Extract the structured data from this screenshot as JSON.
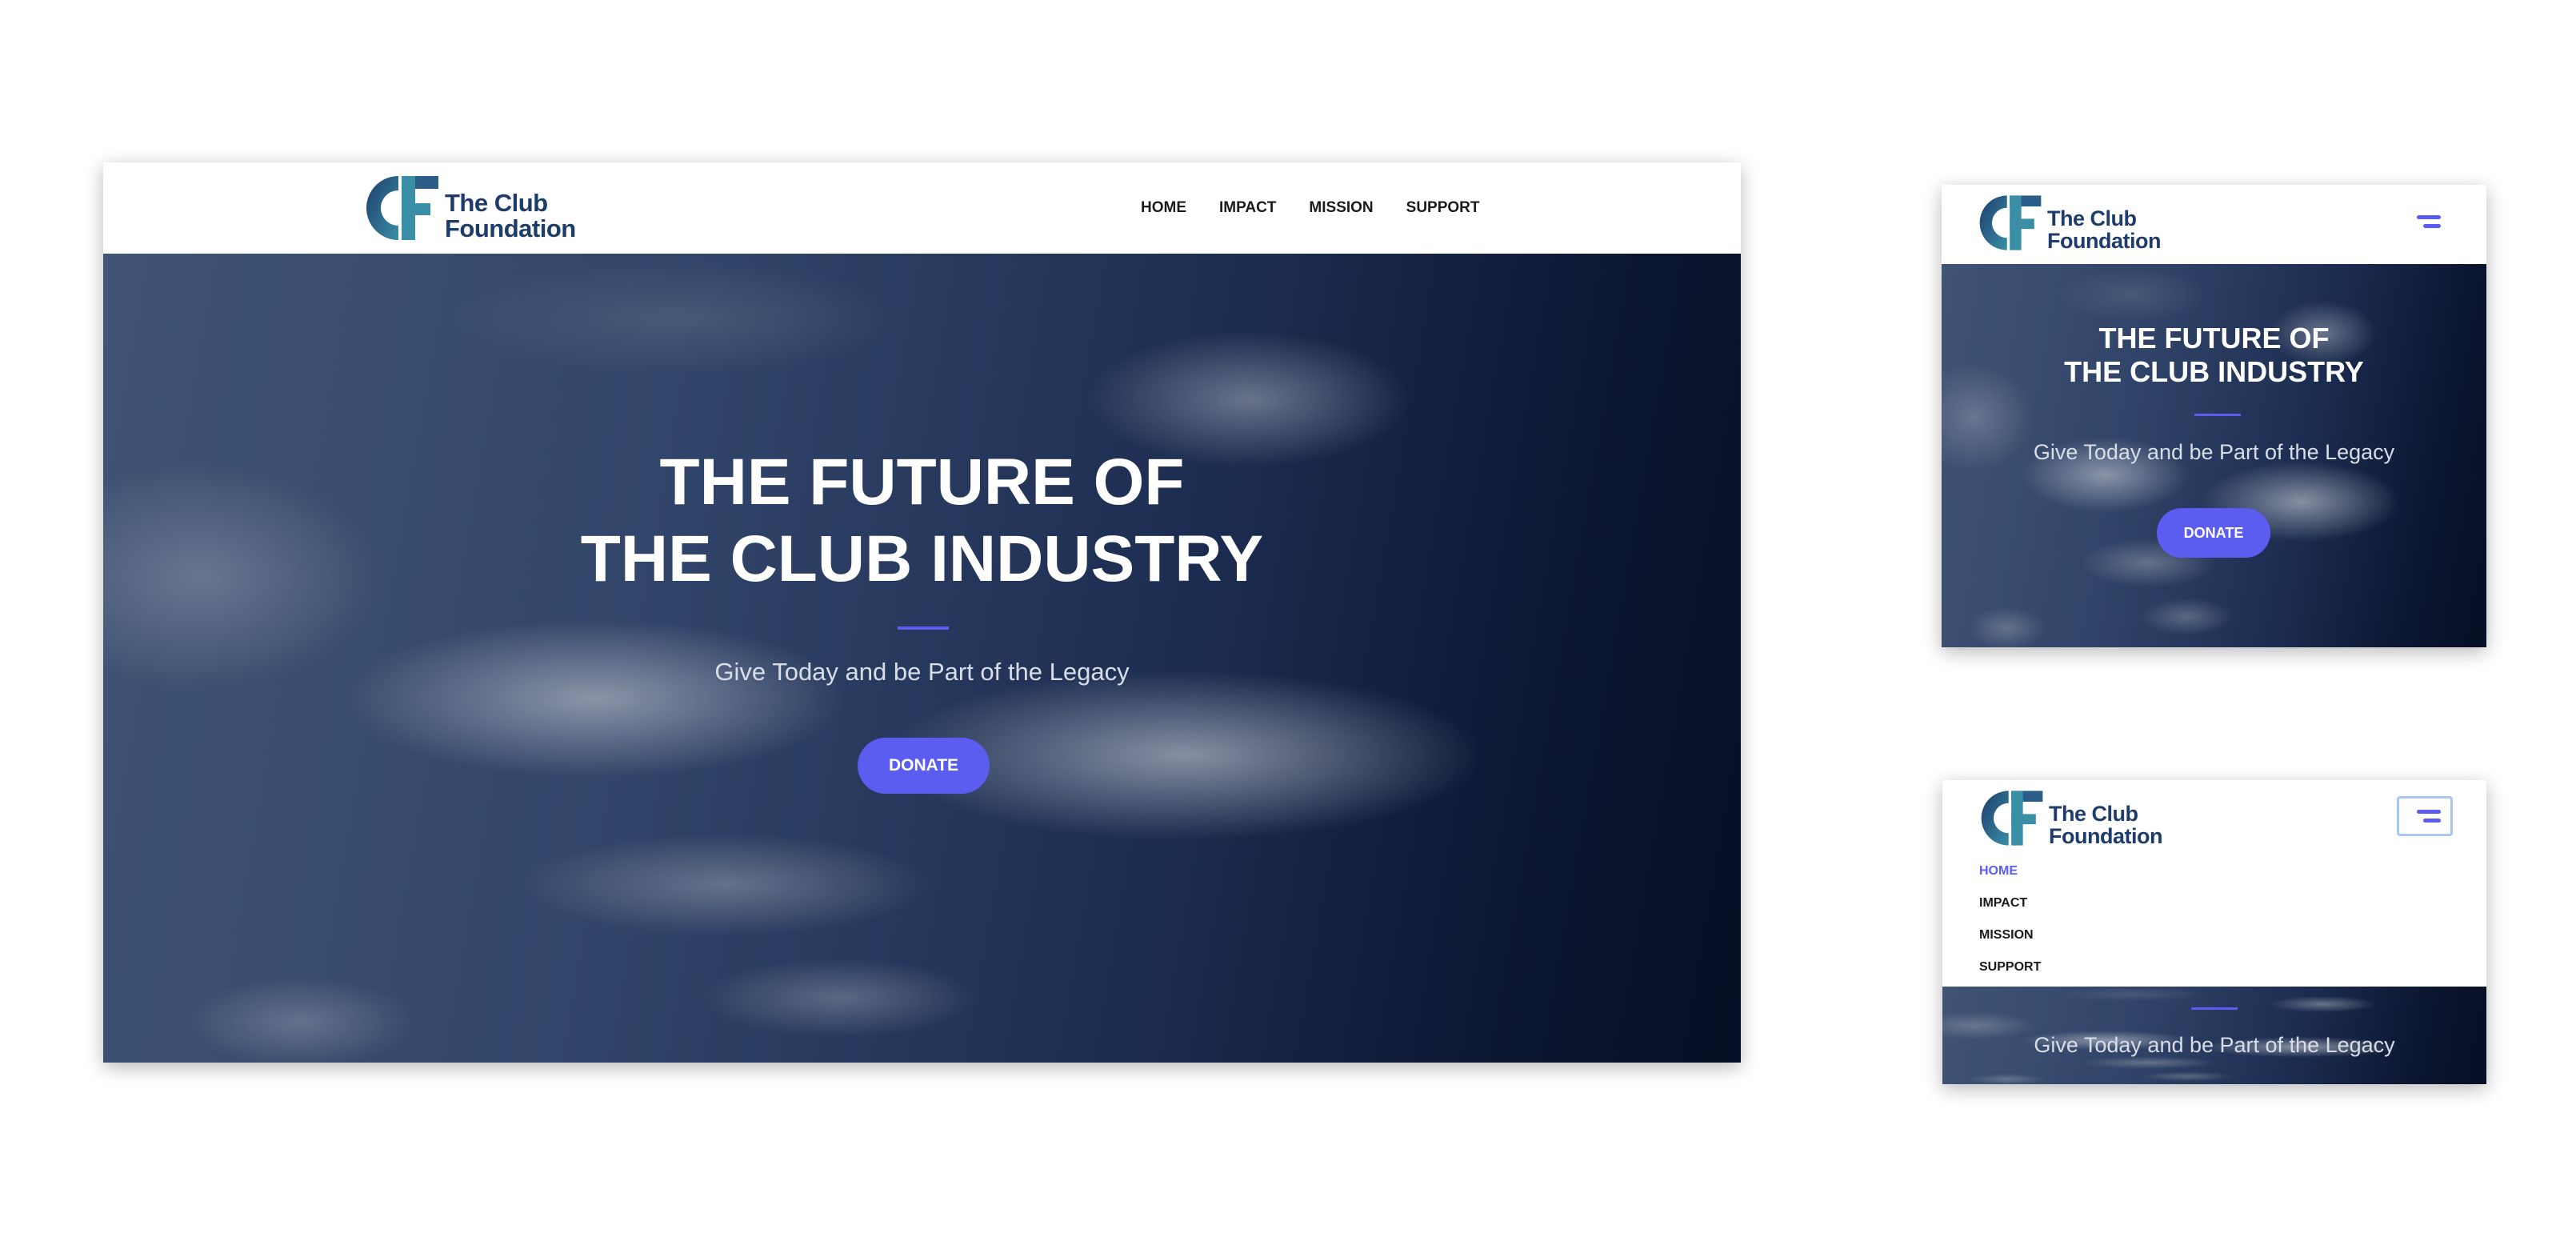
{
  "brand": {
    "logo_icon": "cf-monogram-icon",
    "line1": "The Club",
    "line2": "Foundation",
    "colors": {
      "navy": "#1d3c6b",
      "teal": "#3a8fa6"
    }
  },
  "nav": {
    "items": [
      {
        "label": "HOME"
      },
      {
        "label": "IMPACT"
      },
      {
        "label": "MISSION"
      },
      {
        "label": "SUPPORT"
      }
    ],
    "active_index": 0
  },
  "hero": {
    "title_line1": "THE FUTURE OF",
    "title_line2": "THE CLUB INDUSTRY",
    "tagline": "Give Today and be Part of the Legacy",
    "cta_label": "DONATE"
  },
  "icons": {
    "menu": "hamburger-menu-icon"
  },
  "colors": {
    "accent": "#5b5df0",
    "sky_dark": "#0c1631",
    "text": "#1a1a1a"
  }
}
